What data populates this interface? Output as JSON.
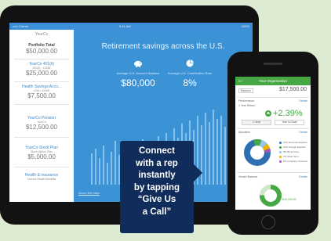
{
  "ipad": {
    "status_bar": {
      "carrier": "••••• Carrier",
      "time": "9:41 AM",
      "battery": "100%"
    },
    "sidebar": {
      "brand": "YourCo",
      "items": [
        {
          "title": "Portfolio Total",
          "subtitle": "",
          "value": "$50,000.00",
          "active": true
        },
        {
          "title": "YourCo 401(k)",
          "subtitle": "401(k) · 12345",
          "value": "$25,000.00"
        },
        {
          "title": "Health Savings Acco...",
          "subtitle": "HSA • 12345",
          "value": "$7,500.00"
        },
        {
          "title": "YourCo Pension",
          "subtitle": "YourCo",
          "value": "$12,500.00"
        },
        {
          "title": "YourCo Stock Plan",
          "subtitle": "Stock Option Plan",
          "value": "$5,000.00"
        },
        {
          "title": "Health & Insurance",
          "subtitle": "Current Health Benefits",
          "value": ""
        }
      ]
    },
    "hero": {
      "title": "Retirement savings across the U.S.",
      "stats": [
        {
          "icon": "piggy-bank-icon",
          "label": "Average U.S. Account Balance",
          "value": "$80,000"
        },
        {
          "icon": "pie-chart-icon",
          "label": "Average U.S. Contribution Rate",
          "value": "8%"
        }
      ],
      "footer_link": "About the Data"
    }
  },
  "callout": {
    "lines": [
      "Connect",
      "with a rep",
      "instantly",
      "by tapping",
      "“Give Us",
      "a Call”"
    ]
  },
  "iphone": {
    "nav": {
      "title": "Your Organization"
    },
    "account": {
      "label": "Balance",
      "value": "$17,500.00"
    },
    "performance": {
      "label": "Performance",
      "details_link": "Details",
      "period": "1 Year Return",
      "change": "+2.39%",
      "tabs": [
        "1 Year",
        "Year to Date"
      ]
    },
    "allocation": {
      "label": "Allocation",
      "details_link": "Details",
      "legend": [
        {
          "name": "Domestic Equities",
          "pct": "70%",
          "color": "#2e6fb2"
        },
        {
          "name": "Foreign Equities",
          "pct": "10%",
          "color": "#46a845"
        },
        {
          "name": "Bond Fund",
          "pct": "8%",
          "color": "#95c7ee"
        },
        {
          "name": "Short Term",
          "pct": "7%",
          "color": "#f0b400"
        },
        {
          "name": "Company Common",
          "pct": "5%",
          "color": "#9b59b6"
        }
      ]
    },
    "vested": {
      "label": "Vested Balance",
      "details_link": "Details",
      "value": "$15,000.00"
    }
  },
  "colors": {
    "ipad_blue": "#3b93d6",
    "callout_navy": "#0f2c5a",
    "green": "#46a845"
  }
}
